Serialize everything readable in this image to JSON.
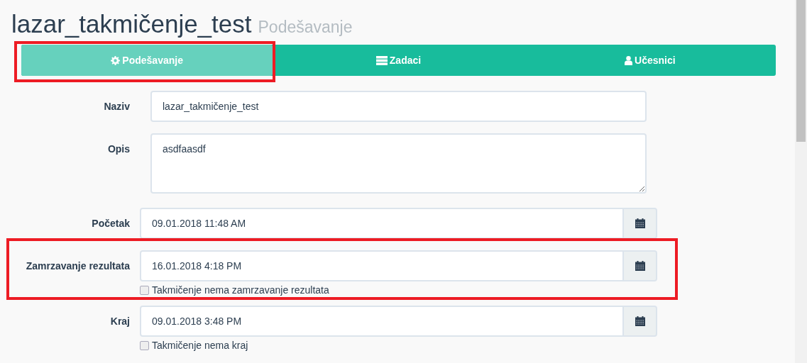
{
  "header": {
    "title": "lazar_takmičenje_test",
    "subtitle": "Podešavanje"
  },
  "tabs": [
    {
      "label": "Podešavanje",
      "selected": true,
      "highlighted": true
    },
    {
      "label": "Zadaci",
      "selected": false,
      "highlighted": false
    },
    {
      "label": "Učesnici",
      "selected": false,
      "highlighted": false
    }
  ],
  "fields": [
    {
      "kind": "text",
      "label": "Naziv",
      "value": "lazar_takmičenje_test",
      "highlighted": false
    },
    {
      "kind": "textarea",
      "label": "Opis",
      "value": "asdfaasdf",
      "highlighted": false
    },
    {
      "kind": "datetime",
      "label": "Početak",
      "value": "09.01.2018 11:48 AM",
      "highlighted": false
    },
    {
      "kind": "datetime",
      "label": "Zamrzavanje rezultata",
      "value": "16.01.2018 4:18 PM",
      "highlighted": true,
      "checkbox": {
        "label": "Takmičenje nema zamrzavanje rezultata",
        "checked": false
      }
    },
    {
      "kind": "datetime",
      "label": "Kraj",
      "value": "09.01.2018 3:48 PM",
      "highlighted": false,
      "checkbox": {
        "label": "Takmičenje nema kraj",
        "checked": false
      }
    }
  ]
}
